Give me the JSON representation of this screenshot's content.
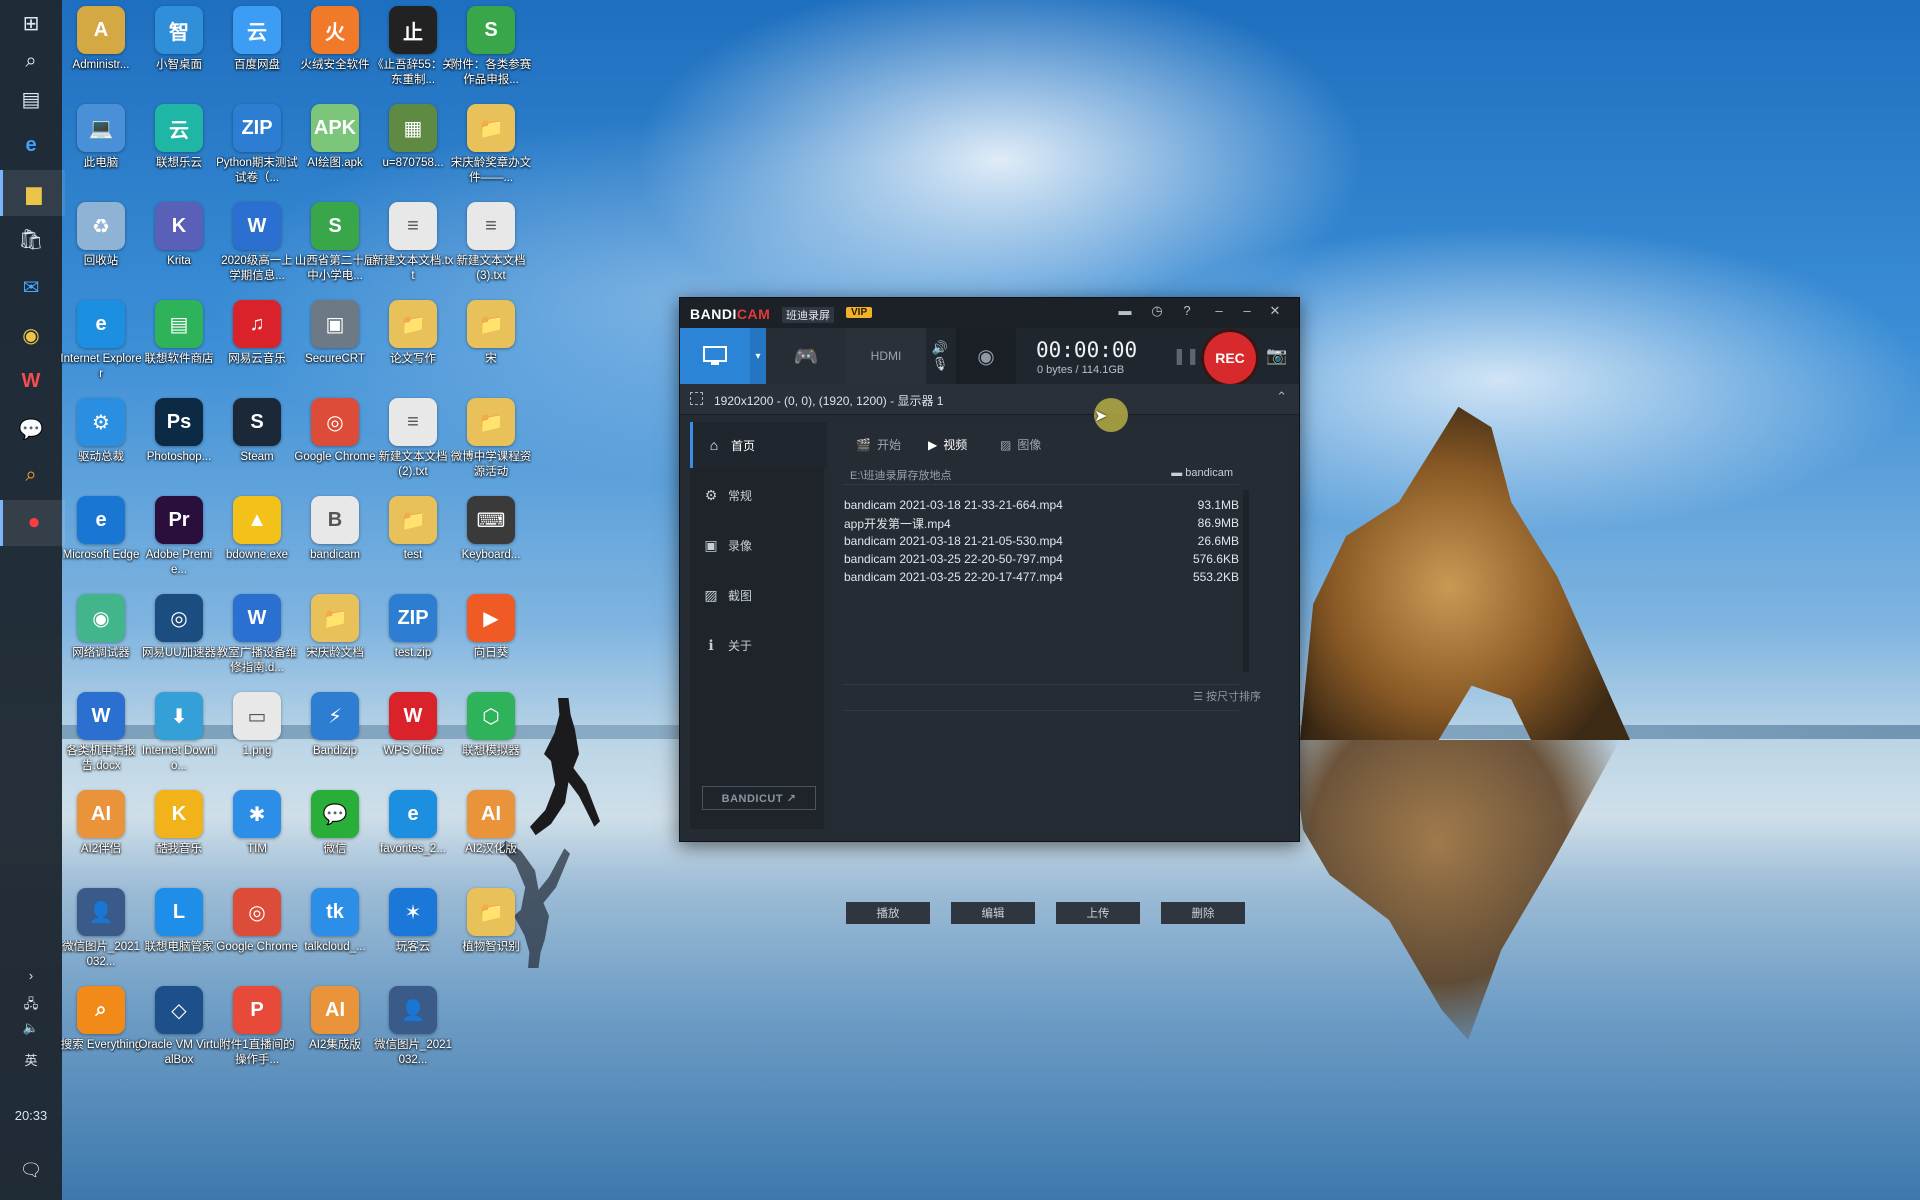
{
  "taskbar": {
    "time": "20:33",
    "ime": "英",
    "buttons": [
      "windows-icon",
      "search-icon",
      "task-view-icon",
      "edge-icon",
      "file-explorer-icon",
      "store-icon",
      "mail-icon",
      "chrome-icon",
      "wps-icon",
      "wechat-icon",
      "search-everything-icon",
      "record-icon"
    ]
  },
  "desktop": {
    "icons": [
      {
        "label": "Administr...",
        "color": "#d4a843",
        "glyph": "A"
      },
      {
        "label": "小智桌面",
        "color": "#2f8fd8",
        "glyph": "智"
      },
      {
        "label": "百度网盘",
        "color": "#3d9df5",
        "glyph": "云"
      },
      {
        "label": "火绒安全软件",
        "color": "#f07a2a",
        "glyph": "火"
      },
      {
        "label": "《止吾辞55：关东重制...",
        "color": "#222222",
        "glyph": "止"
      },
      {
        "label": "附件：各类参赛作品申报...",
        "color": "#3aa64a",
        "glyph": "S"
      },
      {
        "label": "此电脑",
        "color": "#4a90d9",
        "glyph": "💻"
      },
      {
        "label": "联想乐云",
        "color": "#1fb6a6",
        "glyph": "云"
      },
      {
        "label": "Python期末测试试卷（...",
        "color": "#2d7dd2",
        "glyph": "ZIP"
      },
      {
        "label": "AI绘图.apk",
        "color": "#7bc67b",
        "glyph": "APK"
      },
      {
        "label": "u=870758...",
        "color": "#5e8a44",
        "glyph": "▦"
      },
      {
        "label": "宋庆龄奖章办文件——...",
        "color": "#e8c15a",
        "glyph": "📁"
      },
      {
        "label": "回收站",
        "color": "#8fb3d4",
        "glyph": "♻"
      },
      {
        "label": "Krita",
        "color": "#5a5fb8",
        "glyph": "K"
      },
      {
        "label": "2020级高一上学期信息...",
        "color": "#2b6fd1",
        "glyph": "W"
      },
      {
        "label": "山西省第二十届中小学电...",
        "color": "#3aa64a",
        "glyph": "S"
      },
      {
        "label": "新建文本文档.txt",
        "color": "#e8e8e8",
        "glyph": "≡"
      },
      {
        "label": "新建文本文档(3).txt",
        "color": "#e8e8e8",
        "glyph": "≡"
      },
      {
        "label": "Internet Explorer",
        "color": "#1d8fe0",
        "glyph": "e"
      },
      {
        "label": "联想软件商店",
        "color": "#2fb35a",
        "glyph": "▤"
      },
      {
        "label": "网易云音乐",
        "color": "#d9222a",
        "glyph": "♫"
      },
      {
        "label": "SecureCRT",
        "color": "#6d7a86",
        "glyph": "▣"
      },
      {
        "label": "论文写作",
        "color": "#e8c15a",
        "glyph": "📁"
      },
      {
        "label": "宋",
        "color": "#e8c15a",
        "glyph": "📁"
      },
      {
        "label": "驱动总裁",
        "color": "#2a8fe0",
        "glyph": "⚙"
      },
      {
        "label": "Photoshop...",
        "color": "#0d2a45",
        "glyph": "Ps"
      },
      {
        "label": "Steam",
        "color": "#1b2838",
        "glyph": "S"
      },
      {
        "label": "Google Chrome",
        "color": "#dd4b39",
        "glyph": "◎"
      },
      {
        "label": "新建文本文档(2).txt",
        "color": "#e8e8e8",
        "glyph": "≡"
      },
      {
        "label": "微博中学课程资源活动",
        "color": "#e8c15a",
        "glyph": "📁"
      },
      {
        "label": "Microsoft Edge",
        "color": "#1976d2",
        "glyph": "e"
      },
      {
        "label": "Adobe Premie...",
        "color": "#2a0f3d",
        "glyph": "Pr"
      },
      {
        "label": "bdowne.exe",
        "color": "#f2c21a",
        "glyph": "▲"
      },
      {
        "label": "bandicam",
        "color": "#e8e8e8",
        "glyph": "B"
      },
      {
        "label": "test",
        "color": "#e8c15a",
        "glyph": "📁"
      },
      {
        "label": "Keyboard...",
        "color": "#3a3a3a",
        "glyph": "⌨"
      },
      {
        "label": "网络调试器",
        "color": "#43b58a",
        "glyph": "◉"
      },
      {
        "label": "网易UU加速器",
        "color": "#1c4d80",
        "glyph": "◎"
      },
      {
        "label": "教室广播设备维修指南.d...",
        "color": "#2b6fd1",
        "glyph": "W"
      },
      {
        "label": "宋庆龄文档",
        "color": "#e8c15a",
        "glyph": "📁"
      },
      {
        "label": "test.zip",
        "color": "#2d7dd2",
        "glyph": "ZIP"
      },
      {
        "label": "向日葵",
        "color": "#f05a24",
        "glyph": "▶"
      },
      {
        "label": "各类机申请报告.docx",
        "color": "#2b6fd1",
        "glyph": "W"
      },
      {
        "label": "Internet Downlo...",
        "color": "#35a0d8",
        "glyph": "⬇"
      },
      {
        "label": "1.png",
        "color": "#e8e8e8",
        "glyph": "▭"
      },
      {
        "label": "Bandizip",
        "color": "#2d7dd2",
        "glyph": "⚡"
      },
      {
        "label": "WPS Office",
        "color": "#d9222a",
        "glyph": "W"
      },
      {
        "label": "联想模拟器",
        "color": "#2fb35a",
        "glyph": "⬡"
      },
      {
        "label": "AI2伴侣",
        "color": "#e9933a",
        "glyph": "AI"
      },
      {
        "label": "酷我音乐",
        "color": "#f2b31a",
        "glyph": "K"
      },
      {
        "label": "TIM",
        "color": "#2d8ee8",
        "glyph": "✱"
      },
      {
        "label": "微信",
        "color": "#2aae3a",
        "glyph": "💬"
      },
      {
        "label": "favorites_2...",
        "color": "#1d8fe0",
        "glyph": "e"
      },
      {
        "label": "AI2汉化版",
        "color": "#e9933a",
        "glyph": "AI"
      },
      {
        "label": "微信图片_2021032...",
        "color": "#3a5a8a",
        "glyph": "👤"
      },
      {
        "label": "联想电脑管家",
        "color": "#1f8ee8",
        "glyph": "L"
      },
      {
        "label": "Google Chrome",
        "color": "#dd4b39",
        "glyph": "◎"
      },
      {
        "label": "talkcloud_...",
        "color": "#2d8ee8",
        "glyph": "tk"
      },
      {
        "label": "玩客云",
        "color": "#1c78d8",
        "glyph": "✶"
      },
      {
        "label": "植物智识别",
        "color": "#e8c15a",
        "glyph": "📁"
      },
      {
        "label": "搜索 Everything",
        "color": "#f28a1a",
        "glyph": "⌕"
      },
      {
        "label": "Oracle VM VirtualBox",
        "color": "#1d4f8a",
        "glyph": "◇"
      },
      {
        "label": "附件1直播间的操作手...",
        "color": "#e84a3a",
        "glyph": "P"
      },
      {
        "label": "AI2集成版",
        "color": "#e9933a",
        "glyph": "AI"
      },
      {
        "label": "微信图片_2021032...",
        "color": "#3a5a8a",
        "glyph": "👤"
      }
    ]
  },
  "bandicam": {
    "brand": "BANDI",
    "brand_accent": "CAM",
    "subtitle": "班迪录屏",
    "vip": "VIP",
    "timer": "00:00:00",
    "size": "0 bytes / 114.1GB",
    "rec": "REC",
    "area": "1920x1200 - (0, 0), (1920, 1200) - 显示器 1",
    "sidebar": [
      {
        "label": "首页",
        "icon": "home-icon",
        "glyph": "⌂"
      },
      {
        "label": "常规",
        "icon": "gear-icon",
        "glyph": "⚙"
      },
      {
        "label": "录像",
        "icon": "video-icon",
        "glyph": "▣"
      },
      {
        "label": "截图",
        "icon": "image-icon",
        "glyph": "▨"
      },
      {
        "label": "关于",
        "icon": "info-icon",
        "glyph": "ℹ"
      }
    ],
    "bandicut": "BANDICUT ↗",
    "tabs": [
      {
        "label": "开始"
      },
      {
        "label": "视频"
      },
      {
        "label": "图像"
      }
    ],
    "path": "E:\\班迪录屏存放地点",
    "folder_label": "bandicam",
    "files": [
      {
        "name": "bandicam 2021-03-18 21-33-21-664.mp4",
        "size": "93.1MB"
      },
      {
        "name": "app开发第一课.mp4",
        "size": "86.9MB"
      },
      {
        "name": "bandicam 2021-03-18 21-21-05-530.mp4",
        "size": "26.6MB"
      },
      {
        "name": "bandicam 2021-03-25 22-20-50-797.mp4",
        "size": "576.6KB"
      },
      {
        "name": "bandicam 2021-03-25 22-20-17-477.mp4",
        "size": "553.2KB"
      }
    ],
    "sort_label": "按尺寸排序",
    "actions": [
      {
        "label": "播放"
      },
      {
        "label": "编辑"
      },
      {
        "label": "上传"
      },
      {
        "label": "删除"
      }
    ]
  }
}
